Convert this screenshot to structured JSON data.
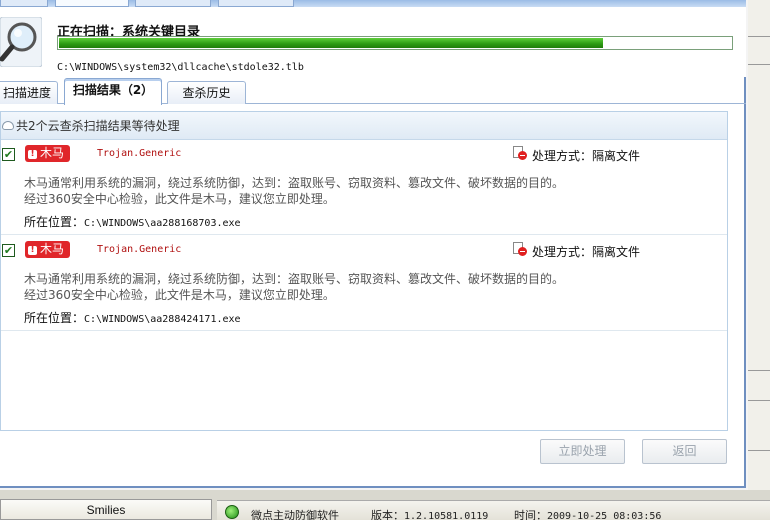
{
  "header": {
    "scan_title": "正在扫描：系统关键目录",
    "progress_percent": 81,
    "current_path": "C:\\WINDOWS\\system32\\dllcache\\stdole32.tlb"
  },
  "tabs": [
    {
      "label": "扫描进度"
    },
    {
      "label": "扫描结果（2）"
    },
    {
      "label": "查杀历史"
    }
  ],
  "results": {
    "summary": "共2个云查杀扫描结果等待处理",
    "items": [
      {
        "checked": "✔",
        "badge": "木马",
        "virus_name": "Trojan.Generic",
        "action_label": "处理方式：",
        "action_value": "隔离文件",
        "desc_line1": "木马通常利用系统的漏洞，绕过系统防御，达到：盗取账号、窃取资料、篡改文件、破坏数据的目的。",
        "desc_line2": "经过360安全中心检验，此文件是木马，建议您立即处理。",
        "location_label": "所在位置：",
        "location": "C:\\WINDOWS\\aa288168703.exe"
      },
      {
        "checked": "✔",
        "badge": "木马",
        "virus_name": "Trojan.Generic",
        "action_label": "处理方式：",
        "action_value": "隔离文件",
        "desc_line1": "木马通常利用系统的漏洞，绕过系统防御，达到：盗取账号、窃取资料、篡改文件、破坏数据的目的。",
        "desc_line2": "经过360安全中心检验，此文件是木马，建议您立即处理。",
        "location_label": "所在位置：",
        "location": "C:\\WINDOWS\\aa288424171.exe"
      }
    ]
  },
  "buttons": {
    "process_now": "立即处理",
    "back": "返回"
  },
  "bottom": {
    "smilies": "Smilies",
    "app_name": "微点主动防御软件",
    "version_label": "版本：",
    "version": "1.2.10581.0119",
    "time_label": "时间：",
    "time": "2009-10-25 08:03:56"
  },
  "icons": {
    "magnifier": "magnifier-icon",
    "cloud": "cloud-icon",
    "warning": "warning-icon",
    "quarantine": "quarantine-icon",
    "status": "shield-status-icon"
  },
  "colors": {
    "progress": "#2b9a12",
    "badge": "#e0262a",
    "virus_name": "#b01010",
    "panel_border": "#b9d0e6"
  }
}
